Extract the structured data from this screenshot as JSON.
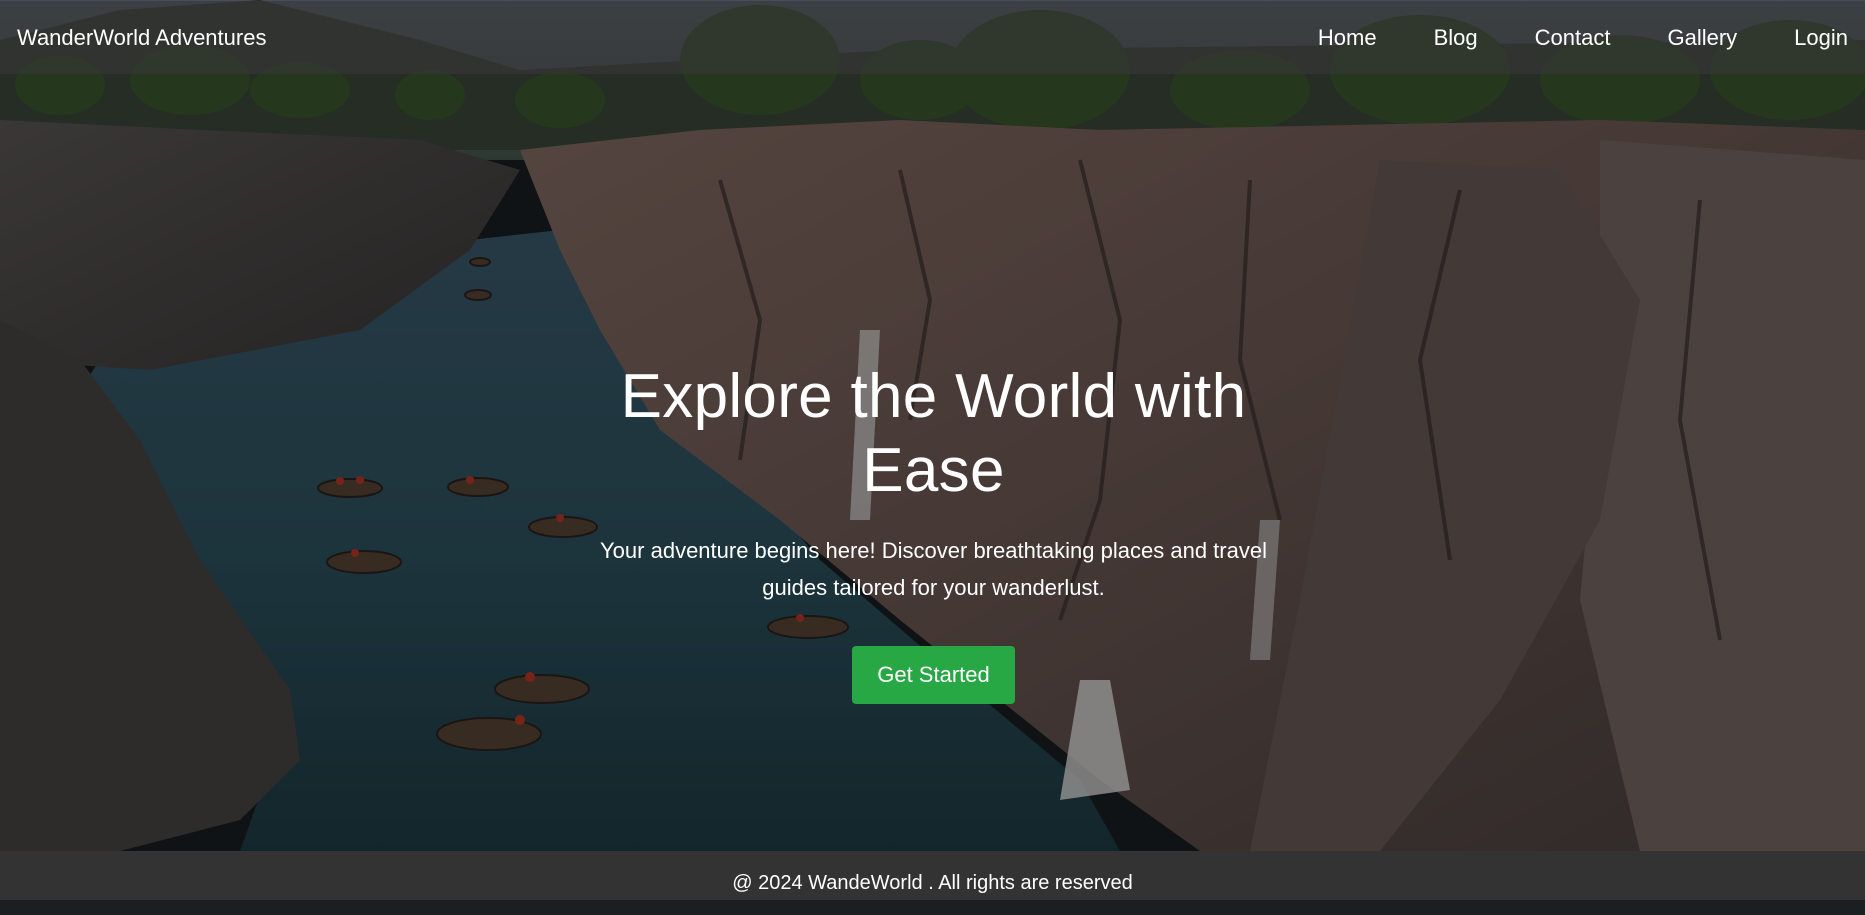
{
  "navbar": {
    "brand": "WanderWorld Adventures",
    "links": [
      {
        "label": "Home"
      },
      {
        "label": "Blog"
      },
      {
        "label": "Contact"
      },
      {
        "label": "Gallery"
      },
      {
        "label": "Login"
      }
    ]
  },
  "hero": {
    "title": "Explore the World with Ease",
    "subtitle": "Your adventure begins here! Discover breathtaking places and travel guides tailored for your wanderlust.",
    "cta_label": "Get Started",
    "background": "canyon river with coracle boats and waterfalls"
  },
  "footer": {
    "text": "@ 2024 WandeWorld . All rights are reserved"
  },
  "colors": {
    "cta": "#28a745",
    "footer_bg": "#333333",
    "navbar_bg": "rgba(55,55,55,0.62)"
  }
}
